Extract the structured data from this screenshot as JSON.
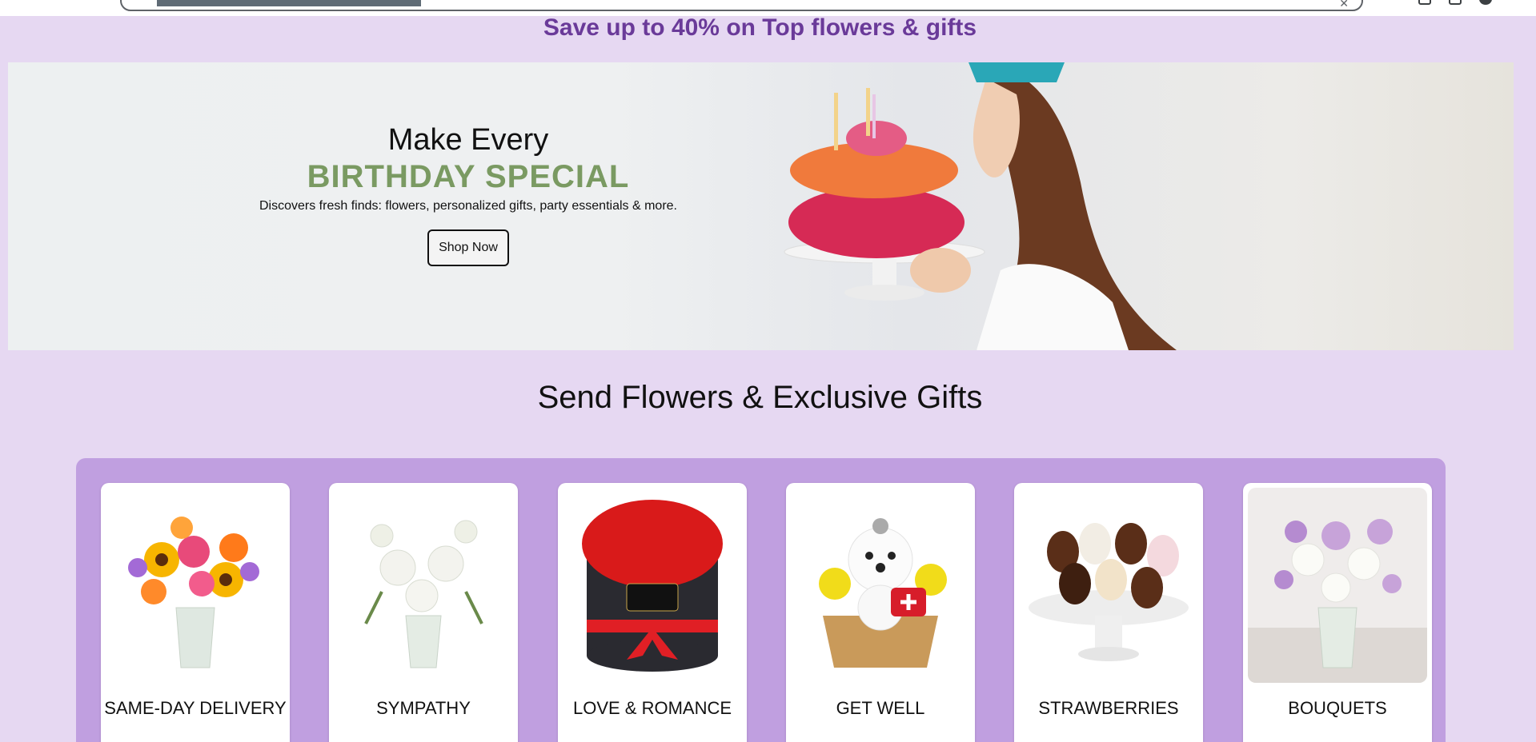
{
  "promo": {
    "text": "Save up to 40% on Top flowers & gifts"
  },
  "hero": {
    "eyebrow": "Make Every",
    "title": "BIRTHDAY SPECIAL",
    "subtitle": "Discovers fresh finds: flowers, personalized gifts, party essentials & more.",
    "button_label": "Shop Now"
  },
  "section": {
    "title": "Send Flowers & Exclusive Gifts"
  },
  "categories": [
    {
      "label": "SAME-DAY DELIVERY",
      "icon": "mixed-bouquet-image"
    },
    {
      "label": "SYMPATHY",
      "icon": "white-lilies-image"
    },
    {
      "label": "LOVE & ROMANCE",
      "icon": "red-roses-box-image"
    },
    {
      "label": "GET WELL",
      "icon": "puppy-arrangement-image"
    },
    {
      "label": "STRAWBERRIES",
      "icon": "chocolate-strawberries-image"
    },
    {
      "label": "BOUQUETS",
      "icon": "lavender-bouquet-image"
    }
  ],
  "colors": {
    "background": "#e6d8f2",
    "promo": "#6a3a99",
    "accent_green": "#7a9a62",
    "panel": "#c09fe0"
  }
}
